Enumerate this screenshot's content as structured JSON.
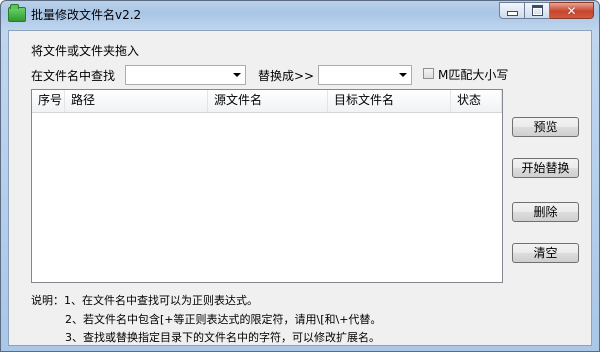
{
  "window": {
    "title": "批量修改文件名v2.2",
    "close_glyph": "✕"
  },
  "drop_hint": "将文件或文件夹拖入",
  "search": {
    "label": "在文件名中查找",
    "value": ""
  },
  "replace": {
    "label": "替换成>>",
    "value": ""
  },
  "match_case": {
    "label": "M匹配大小写",
    "checked": false
  },
  "list": {
    "columns": [
      "序号",
      "路径",
      "源文件名",
      "目标文件名",
      "状态"
    ],
    "rows": []
  },
  "buttons": {
    "preview": "预览",
    "start": "开始替换",
    "delete": "删除",
    "clear": "清空"
  },
  "notes": {
    "line1": "说明：1、在文件名中查找可以为正则表达式。",
    "line2": "2、若文件名中包含[+等正则表达式的限定符，请用\\[和\\+代替。",
    "line3": "3、查找或替换指定目录下的文件名中的字符，可以修改扩展名。"
  }
}
